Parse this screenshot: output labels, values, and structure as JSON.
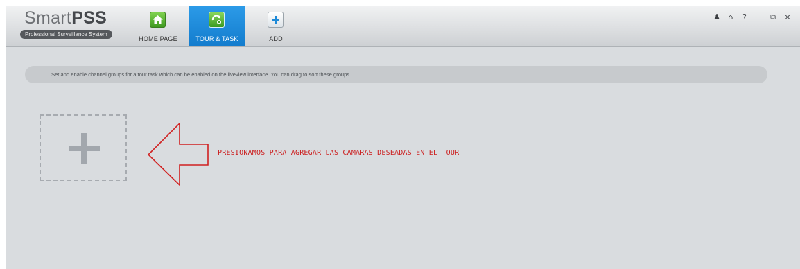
{
  "app": {
    "logo_main": "Smart",
    "logo_bold": "PSS",
    "logo_subtitle": "Professional Surveillance System"
  },
  "tabs": [
    {
      "label": "HOME PAGE",
      "icon": "home-icon",
      "active": false
    },
    {
      "label": "TOUR & TASK",
      "icon": "tour-task-icon",
      "active": true
    },
    {
      "label": "ADD",
      "icon": "plus-icon",
      "active": false
    }
  ],
  "window_controls": {
    "user": "♟",
    "lock": "⌂",
    "help": "?",
    "minimize": "−",
    "restore": "⧉",
    "close": "×"
  },
  "content": {
    "info_text": "Set and enable channel groups for a tour task which can be enabled on the liveview interface. You can drag to sort these groups.",
    "annotation": "PRESIONAMOS PARA AGREGAR LAS CAMARAS DESEADAS EN EL TOUR"
  },
  "colors": {
    "active_tab": "#1b86d8",
    "background": "#d9dcdf",
    "annotation": "#cc2020"
  }
}
